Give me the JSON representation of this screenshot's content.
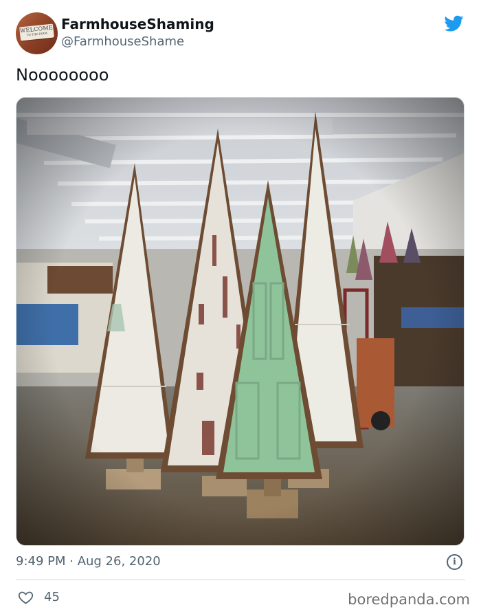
{
  "tweet": {
    "display_name": "FarmhouseShaming",
    "handle": "@FarmhouseShame",
    "text": "Noooooooo",
    "timestamp": "9:49 PM · Aug 26, 2020",
    "like_count": "45"
  },
  "avatar": {
    "sign_line1": "WELCOME",
    "sign_line2": "TO THE FARM"
  },
  "icons": {
    "platform": "twitter-bird-icon",
    "info": "info-icon",
    "like": "heart-icon"
  },
  "footer": {
    "watermark": "boredpanda.com"
  },
  "colors": {
    "twitter_blue": "#1d9bf0",
    "secondary_text": "#536471",
    "primary_text": "#0f1419",
    "divider": "#cfd9de"
  },
  "photo": {
    "subject": "door-triangle-christmas-trees"
  }
}
